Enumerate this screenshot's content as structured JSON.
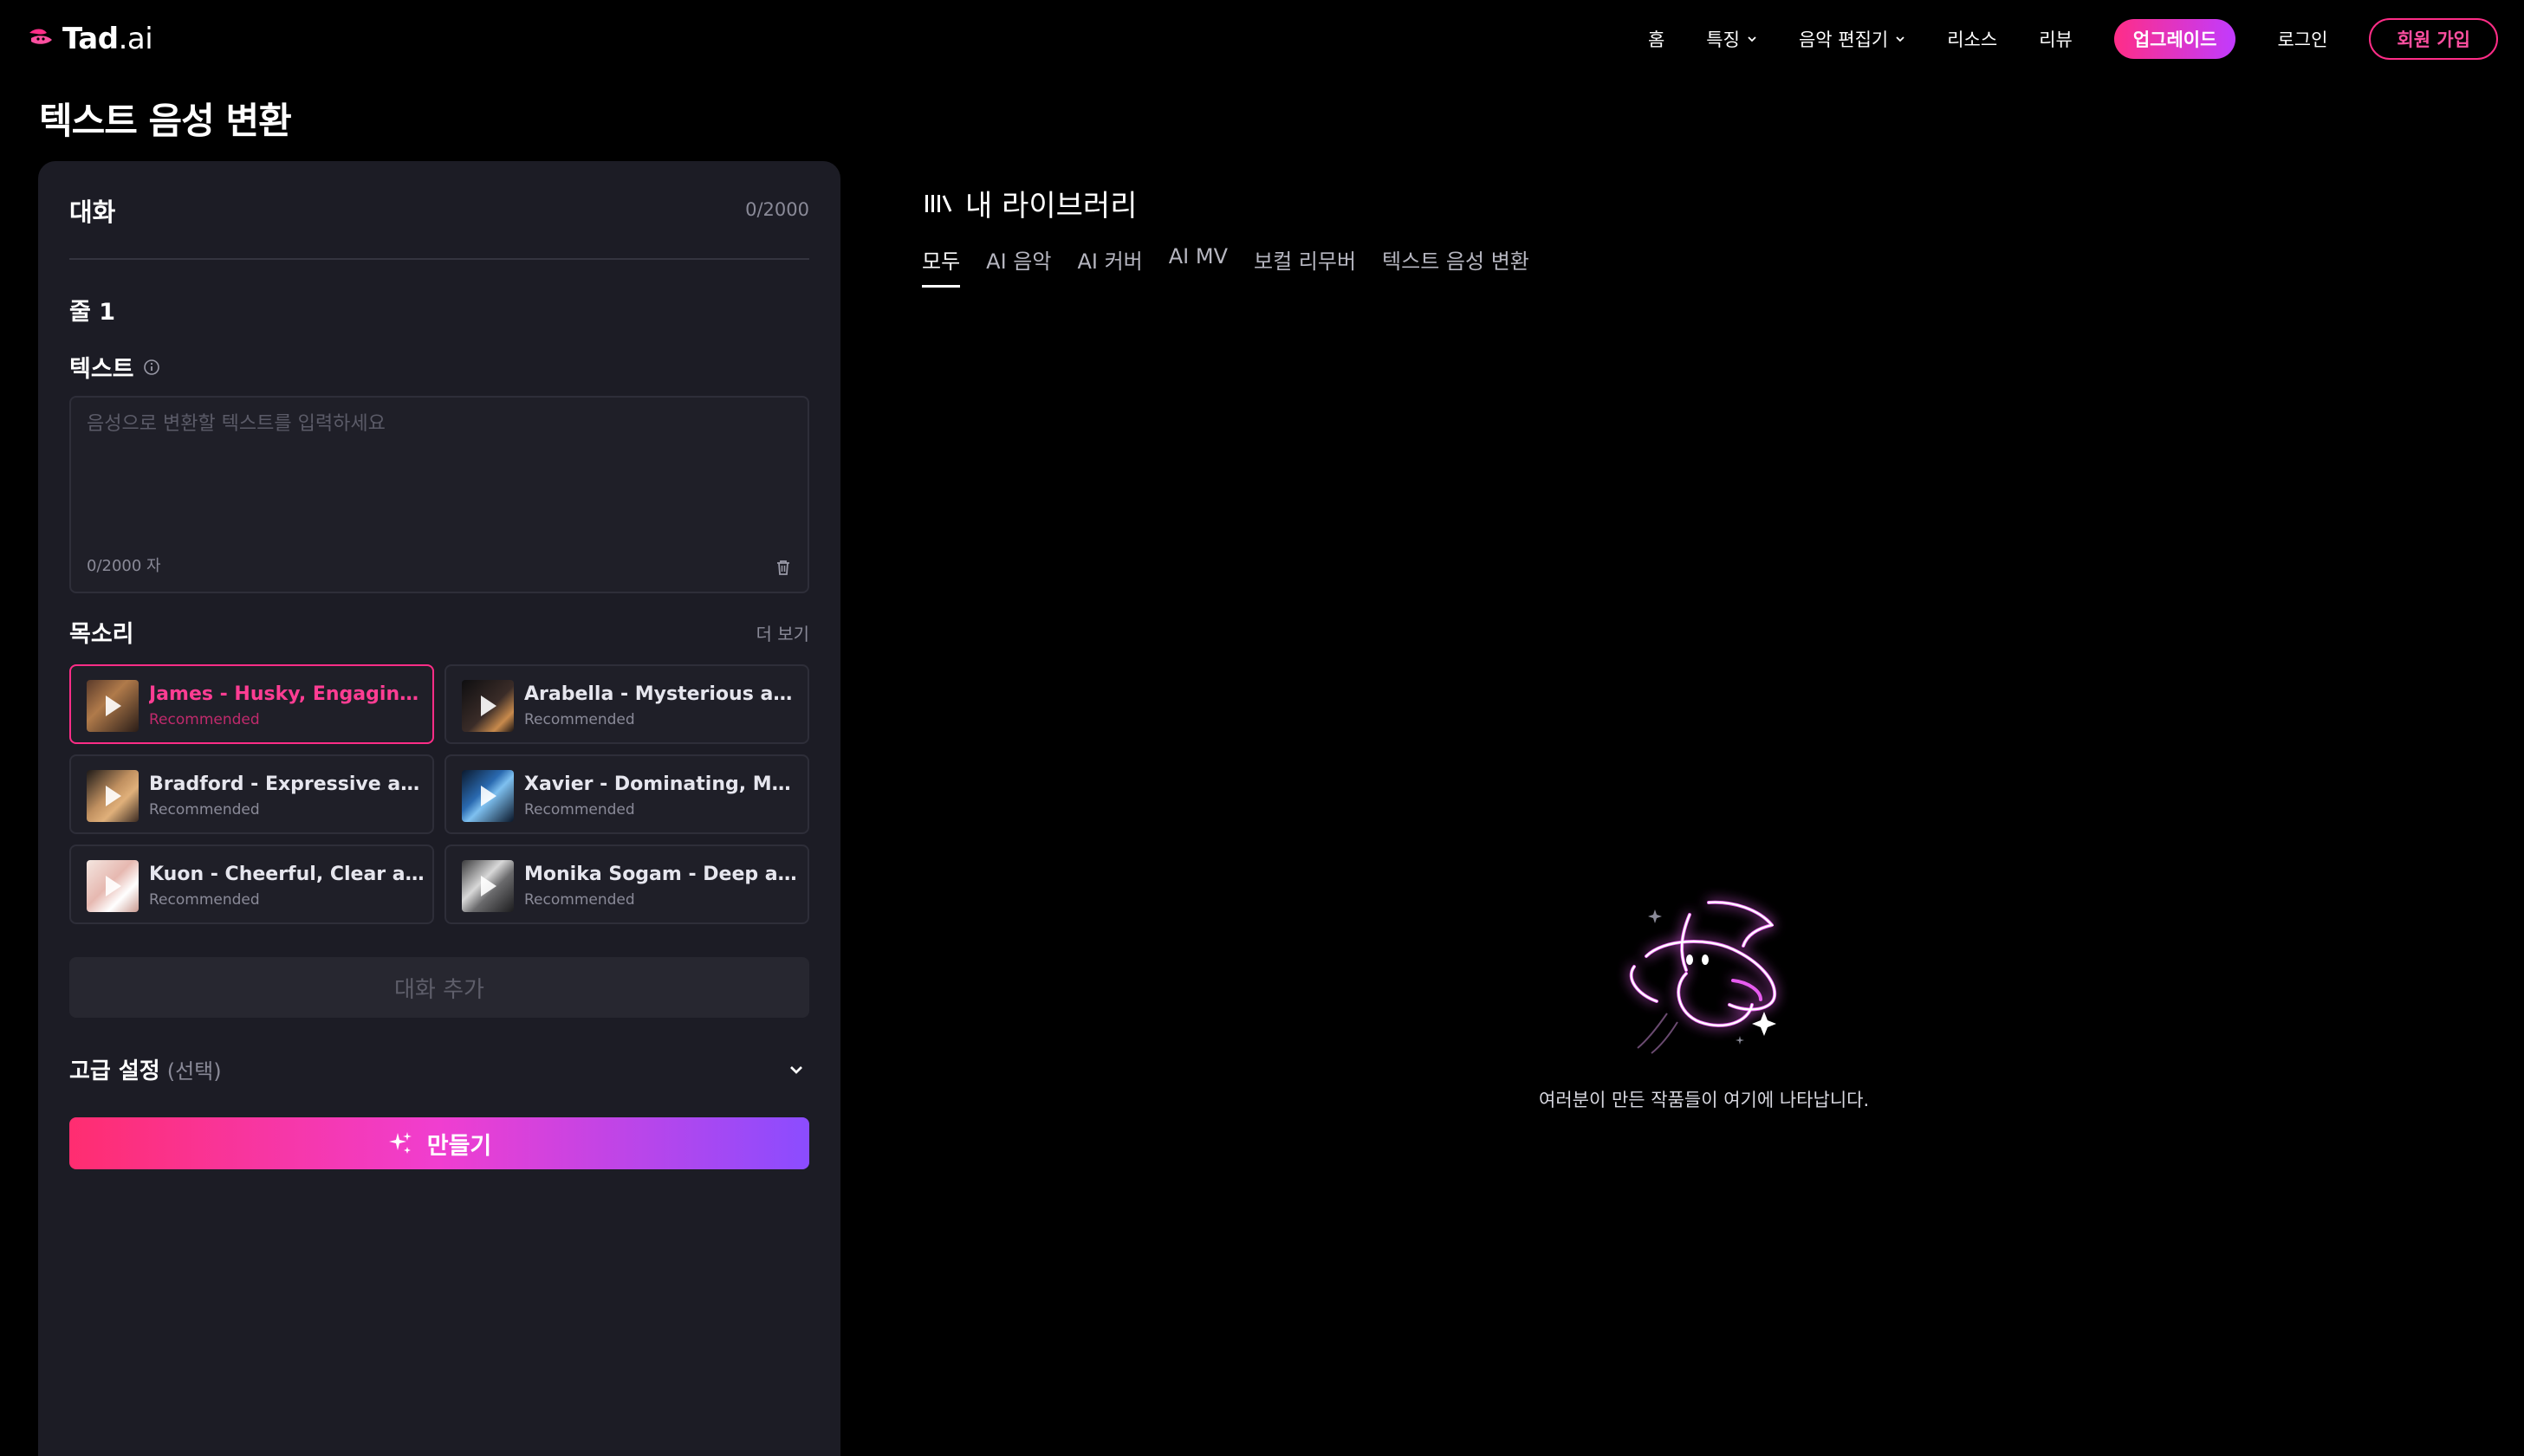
{
  "brand": {
    "logo_main": "Tad",
    "logo_suffix": ".ai",
    "accent": "#ff2d87",
    "accent2": "#c13bff"
  },
  "nav": {
    "items": [
      "홈",
      "특징",
      "음악 편집기",
      "리소스",
      "리뷰"
    ],
    "upgrade": "업그레이드",
    "login": "로그인",
    "signup": "회원 가입"
  },
  "page": {
    "title": "텍스트 음성 변환"
  },
  "dialog": {
    "title": "대화",
    "count": "0/2000",
    "line_label": "줄 1",
    "text_label": "텍스트",
    "text_placeholder": "음성으로 변환할 텍스트를 입력하세요",
    "char_count": "0/2000 자"
  },
  "voices": {
    "title": "목소리",
    "more": "더 보기",
    "items": [
      {
        "name": "James - Husky, Engaging an...",
        "tag": "Recommended",
        "selected": true
      },
      {
        "name": "Arabella - Mysterious and E...",
        "tag": "Recommended",
        "selected": false
      },
      {
        "name": "Bradford - Expressive and Ar...",
        "tag": "Recommended",
        "selected": false
      },
      {
        "name": "Xavier - Dominating, Metalic ...",
        "tag": "Recommended",
        "selected": false
      },
      {
        "name": "Kuon - Cheerful, Clear and S...",
        "tag": "Recommended",
        "selected": false
      },
      {
        "name": "Monika Sogam - Deep and N...",
        "tag": "Recommended",
        "selected": false
      }
    ]
  },
  "actions": {
    "add_dialog": "대화 추가",
    "advanced_title": "고급 설정",
    "advanced_optional": "(선택)",
    "create": "만들기"
  },
  "library": {
    "title": "내 라이브러리",
    "tabs": [
      "모두",
      "AI 음악",
      "AI 커버",
      "AI MV",
      "보컬 리무버",
      "텍스트 음성 변환"
    ],
    "active_tab": 0,
    "empty_message": "여러분이 만든 작품들이 여기에 나타납니다."
  }
}
